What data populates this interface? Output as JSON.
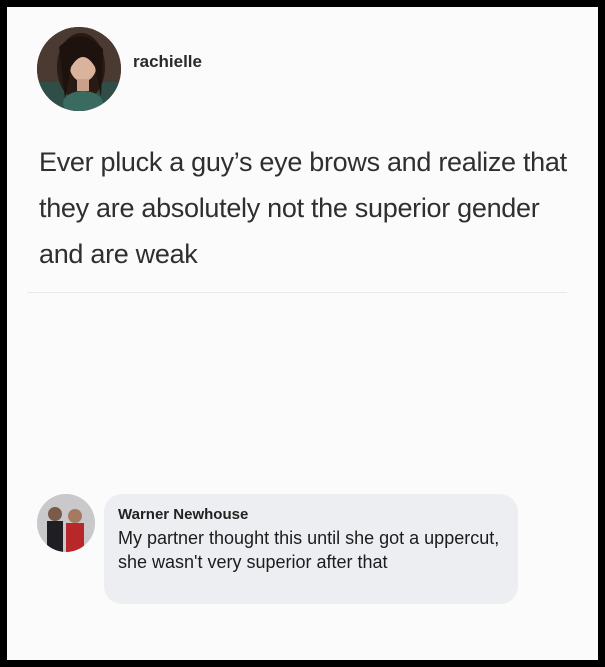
{
  "post": {
    "username": "rachielle",
    "text": "Ever pluck a guy’s eye brows and realize that they are absolutely not the superior gender and are weak"
  },
  "comment": {
    "author": "Warner Newhouse",
    "text": "My partner thought this until she got a uppercut, she wasn't very superior after that"
  }
}
